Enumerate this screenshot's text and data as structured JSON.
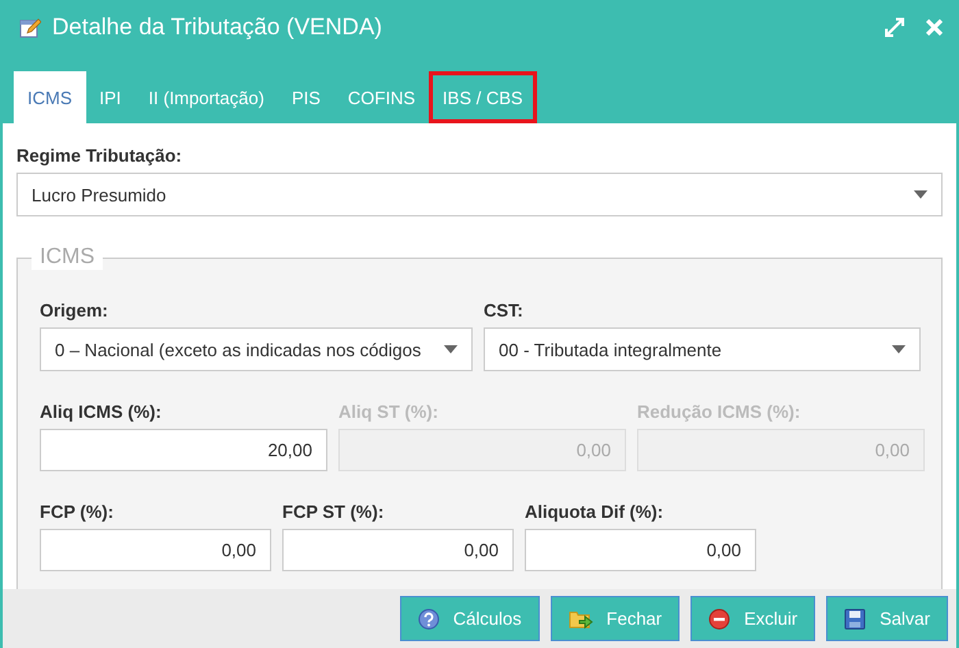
{
  "window": {
    "title": "Detalhe da Tributação (VENDA)"
  },
  "tabs": [
    {
      "label": "ICMS",
      "selected": true,
      "highlighted": false
    },
    {
      "label": "IPI",
      "selected": false,
      "highlighted": false
    },
    {
      "label": "II (Importação)",
      "selected": false,
      "highlighted": false
    },
    {
      "label": "PIS",
      "selected": false,
      "highlighted": false
    },
    {
      "label": "COFINS",
      "selected": false,
      "highlighted": false
    },
    {
      "label": "IBS / CBS",
      "selected": false,
      "highlighted": true
    }
  ],
  "regime": {
    "label": "Regime Tributação:",
    "value": "Lucro Presumido"
  },
  "section": {
    "legend": "ICMS",
    "rows": [
      [
        {
          "kind": "select",
          "label": "Origem:",
          "value": "0 – Nacional (exceto as indicadas nos códigos",
          "disabled": false
        },
        {
          "kind": "select",
          "label": "CST:",
          "value": "00 - Tributada integralmente",
          "disabled": false
        }
      ],
      [
        {
          "kind": "input",
          "label": "Aliq ICMS (%):",
          "value": "20,00",
          "disabled": false
        },
        {
          "kind": "input",
          "label": "Aliq ST (%):",
          "value": "0,00",
          "disabled": true
        },
        {
          "kind": "input",
          "label": "Redução ICMS (%):",
          "value": "0,00",
          "disabled": true
        }
      ],
      [
        {
          "kind": "input",
          "label": "FCP (%):",
          "value": "0,00",
          "disabled": false
        },
        {
          "kind": "input",
          "label": "FCP ST (%):",
          "value": "0,00",
          "disabled": false
        },
        {
          "kind": "input",
          "label": "Aliquota Dif (%):",
          "value": "0,00",
          "disabled": false
        }
      ]
    ]
  },
  "buttons": [
    {
      "kind": "help",
      "label": "Cálculos"
    },
    {
      "kind": "close",
      "label": "Fechar"
    },
    {
      "kind": "delete",
      "label": "Excluir"
    },
    {
      "kind": "save",
      "label": "Salvar"
    }
  ]
}
